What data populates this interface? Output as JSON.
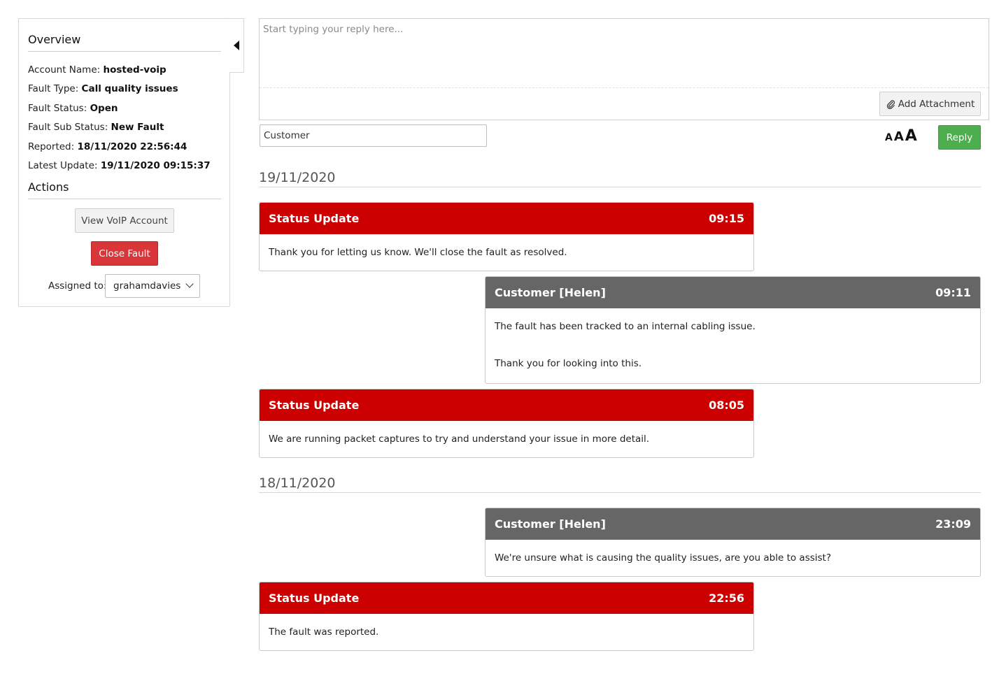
{
  "sidebar": {
    "overview_title": "Overview",
    "rows": [
      {
        "label": "Account Name:",
        "value": "hosted-voip"
      },
      {
        "label": "Fault Type:",
        "value": "Call quality issues"
      },
      {
        "label": "Fault Status:",
        "value": "Open"
      },
      {
        "label": "Fault Sub Status:",
        "value": "New Fault"
      },
      {
        "label": "Reported:",
        "value": "18/11/2020 22:56:44"
      },
      {
        "label": "Latest Update:",
        "value": "19/11/2020 09:15:37"
      }
    ],
    "actions_title": "Actions",
    "view_account_label": "View VoIP Account",
    "close_fault_label": "Close Fault",
    "assigned_label": "Assigned to:",
    "assigned_value": "grahamdavies"
  },
  "reply": {
    "placeholder": "Start typing your reply here...",
    "attach_label": "Add Attachment",
    "audience_value": "Customer",
    "font_sizes": [
      "A",
      "A",
      "A"
    ],
    "reply_label": "Reply"
  },
  "timeline": [
    {
      "date": "19/11/2020",
      "messages": [
        {
          "type": "status",
          "title": "Status Update",
          "time": "09:15",
          "body": [
            "Thank you for letting us know. We'll close the fault as resolved."
          ]
        },
        {
          "type": "customer",
          "title": "Customer [Helen]",
          "time": "09:11",
          "body": [
            "The fault has been tracked to an internal cabling issue.",
            "Thank you for looking into this."
          ]
        },
        {
          "type": "status",
          "title": "Status Update",
          "time": "08:05",
          "body": [
            "We are running packet captures to try and understand your issue in more detail."
          ]
        }
      ]
    },
    {
      "date": "18/11/2020",
      "messages": [
        {
          "type": "customer",
          "title": "Customer [Helen]",
          "time": "23:09",
          "body": [
            "We're unsure what is causing the quality issues, are you able to assist?"
          ]
        },
        {
          "type": "status",
          "title": "Status Update",
          "time": "22:56",
          "body": [
            "The fault was reported."
          ]
        }
      ]
    }
  ],
  "colors": {
    "status_header": "#cc0000",
    "customer_header": "#666666",
    "reply_button": "#4cae4c",
    "close_fault_button": "#d9363a"
  },
  "icons": [
    "collapse-left-icon",
    "paperclip-icon",
    "chevron-down-icon"
  ]
}
